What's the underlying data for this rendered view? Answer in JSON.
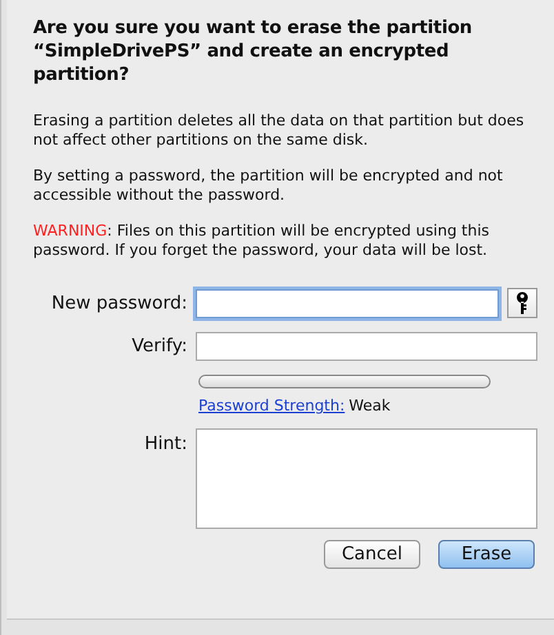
{
  "dialog": {
    "title": "Are you sure you want to erase the partition “SimpleDrivePS” and create an encrypted partition?",
    "paragraphs": [
      "Erasing a partition deletes all the data on that partition but does not affect other partitions on the same disk.",
      "By setting a password, the partition will be encrypted and not accessible without the password."
    ],
    "warning": {
      "label": "WARNING",
      "text": ": Files on this partition will be encrypted using this password. If you forget the password, your data will be lost."
    },
    "new_password": {
      "label": "New password:",
      "focused": true
    },
    "verify": {
      "label": "Verify:",
      "focused": false
    },
    "strength": {
      "level": 0,
      "link": "Password Strength:",
      "value": "Weak"
    },
    "hint": {
      "label": "Hint:"
    },
    "buttons": [
      {
        "label": "Cancel",
        "default": false
      },
      {
        "label": "Erase",
        "default": true
      }
    ]
  }
}
